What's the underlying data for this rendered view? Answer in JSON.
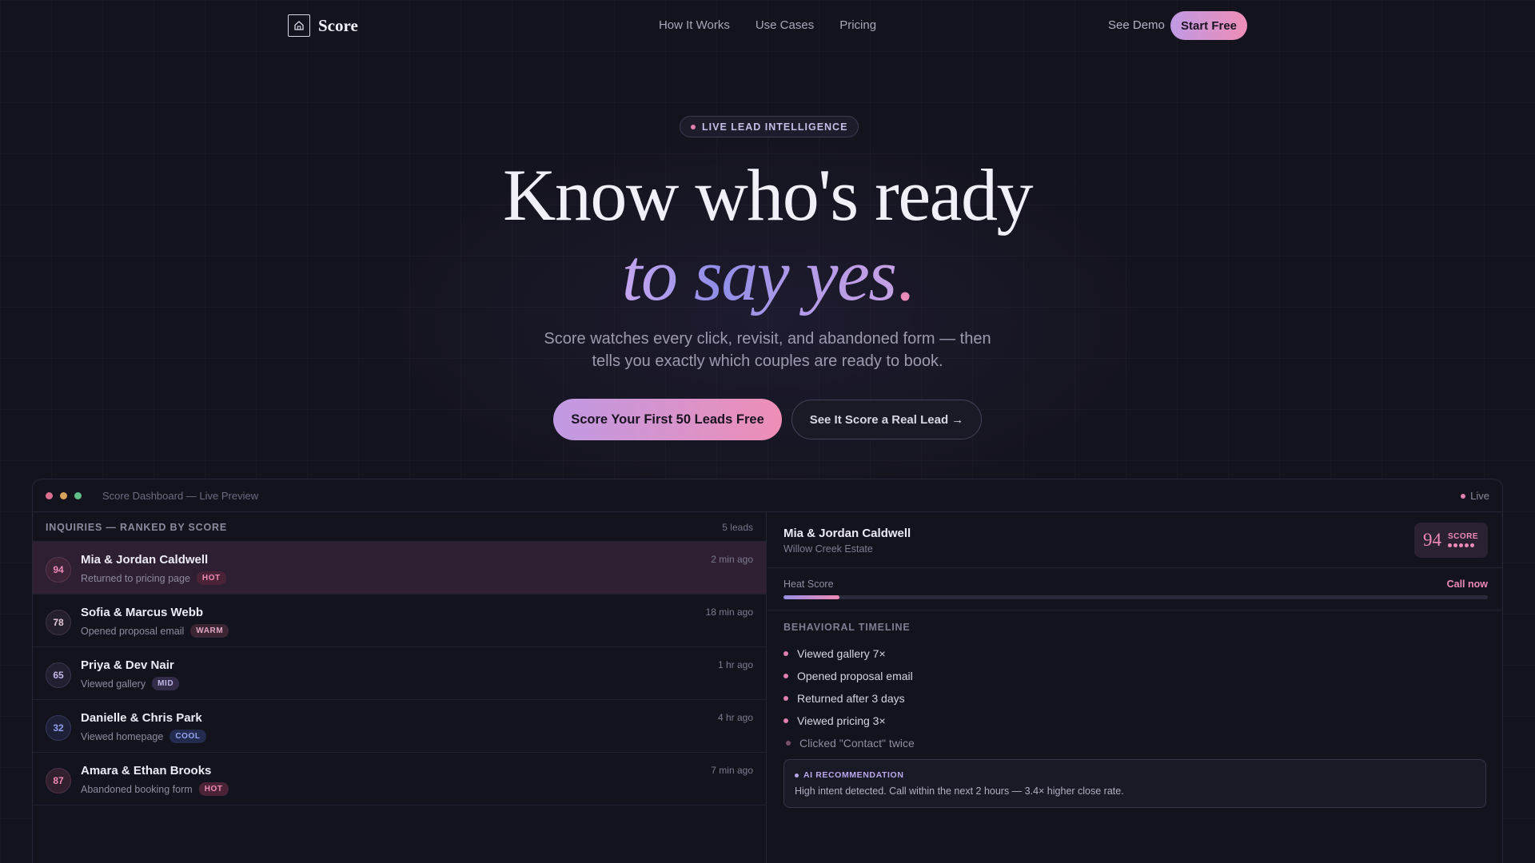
{
  "nav": {
    "brand": "Score",
    "links": [
      "How It Works",
      "Use Cases",
      "Pricing"
    ],
    "see_demo": "See Demo",
    "start_free": "Start Free"
  },
  "hero": {
    "badge": "LIVE LEAD INTELLIGENCE",
    "headline_line1": "Know who's ready",
    "headline_line2": "to say yes",
    "headline_period": ".",
    "subtitle_line1": "Score watches every click, revisit, and abandoned form — then",
    "subtitle_line2": "tells you exactly which couples are ready to book.",
    "cta_primary": "Score Your First 50 Leads Free",
    "cta_secondary": "See It Score a Real Lead →"
  },
  "dashboard": {
    "window_title": "Score Dashboard — Live Preview",
    "live_label": "Live",
    "list_header": "INQUIRIES — RANKED BY SCORE",
    "lead_count": "5 leads",
    "leads": [
      {
        "score": "94",
        "name": "Mia & Jordan Caldwell",
        "activity": "Returned to pricing page",
        "tag": "HOT",
        "time": "2 min ago"
      },
      {
        "score": "78",
        "name": "Sofia & Marcus Webb",
        "activity": "Opened proposal email",
        "tag": "WARM",
        "time": "18 min ago"
      },
      {
        "score": "65",
        "name": "Priya & Dev Nair",
        "activity": "Viewed gallery",
        "tag": "MID",
        "time": "1 hr ago"
      },
      {
        "score": "32",
        "name": "Danielle & Chris Park",
        "activity": "Viewed homepage",
        "tag": "COOL",
        "time": "4 hr ago"
      },
      {
        "score": "87",
        "name": "Amara & Ethan Brooks",
        "activity": "Abandoned booking form",
        "tag": "HOT",
        "time": "7 min ago"
      }
    ],
    "detail": {
      "name": "Mia & Jordan Caldwell",
      "venue": "Willow Creek Estate",
      "score": "94",
      "score_label": "SCORE",
      "heat_label": "Heat Score",
      "heat_action": "Call now",
      "heat_fraction": 0.08,
      "timeline_header": "BEHAVIORAL TIMELINE",
      "timeline": [
        "Viewed gallery 7×",
        "Opened proposal email",
        "Returned after 3 days",
        "Viewed pricing 3×",
        "Clicked \"Contact\" twice"
      ],
      "ai_title": "AI RECOMMENDATION",
      "ai_message": "High intent detected. Call within the next 2 hours — 3.4× higher close rate."
    }
  },
  "colors": {
    "accent_pink": "#ee8ab6",
    "accent_purple": "#c09ae4",
    "background": "#13131d"
  }
}
